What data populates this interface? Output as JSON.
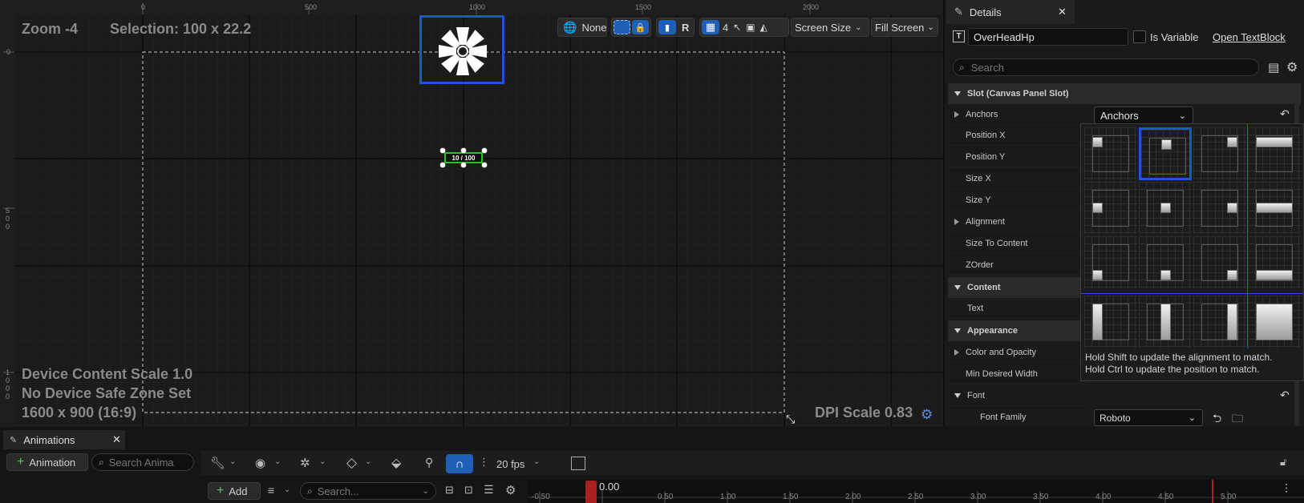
{
  "viewport": {
    "zoom": "Zoom -4",
    "selection": "Selection: 100 x 22.2",
    "device_scale": "Device Content Scale 1.0",
    "safe_zone": "No Device Safe Zone Set",
    "resolution": "1600 x 900 (16:9)",
    "dpi": "DPI Scale 0.83",
    "widget_text": "10 / 100",
    "ruler_top": [
      "0",
      "500",
      "1000",
      "1500",
      "2000"
    ],
    "ruler_left_0": "0",
    "ruler_left_500": [
      "5",
      "0",
      "0"
    ],
    "ruler_left_1000": [
      "1",
      "0",
      "0",
      "0"
    ],
    "toolbar": {
      "localization": "None",
      "respect_locks": "R",
      "grid_size": "4",
      "screen_size": "Screen Size",
      "fill_screen": "Fill Screen"
    }
  },
  "details": {
    "tab_title": "Details",
    "widget_name": "OverHeadHp",
    "is_variable": "Is Variable",
    "open_link": "Open TextBlock",
    "search_placeholder": "Search",
    "categories": {
      "slot": "Slot (Canvas Panel Slot)",
      "content": "Content",
      "appearance": "Appearance",
      "font": "Font"
    },
    "props": {
      "anchors": "Anchors",
      "position_x": "Position X",
      "position_y": "Position Y",
      "size_x": "Size X",
      "size_y": "Size Y",
      "alignment": "Alignment",
      "size_to_content": "Size To Content",
      "zorder": "ZOrder",
      "text": "Text",
      "color_opacity": "Color and Opacity",
      "min_desired_width": "Min Desired Width",
      "font_family": "Font Family"
    },
    "anchors_dropdown": "Anchors",
    "font_family_value": "Roboto",
    "popup_hint_1": "Hold Shift to update the alignment to match.",
    "popup_hint_2": "Hold Ctrl to update the position to match."
  },
  "bottom": {
    "tab_title": "Animations",
    "animation_button": "Animation",
    "search_anim_placeholder": "Search Anima",
    "add_button": "Add",
    "search_placeholder": "Search...",
    "fps": "20 fps",
    "playhead": "0.00",
    "timeline_ticks": [
      "-0.50",
      "0.50",
      "1.00",
      "1.50",
      "2.00",
      "2.50",
      "3.00",
      "3.50",
      "4.00",
      "4.50",
      "5.00"
    ]
  },
  "colors": {
    "accent_blue": "#1f5fb8",
    "selection_green": "#22c522",
    "playhead_red": "#a82020"
  }
}
